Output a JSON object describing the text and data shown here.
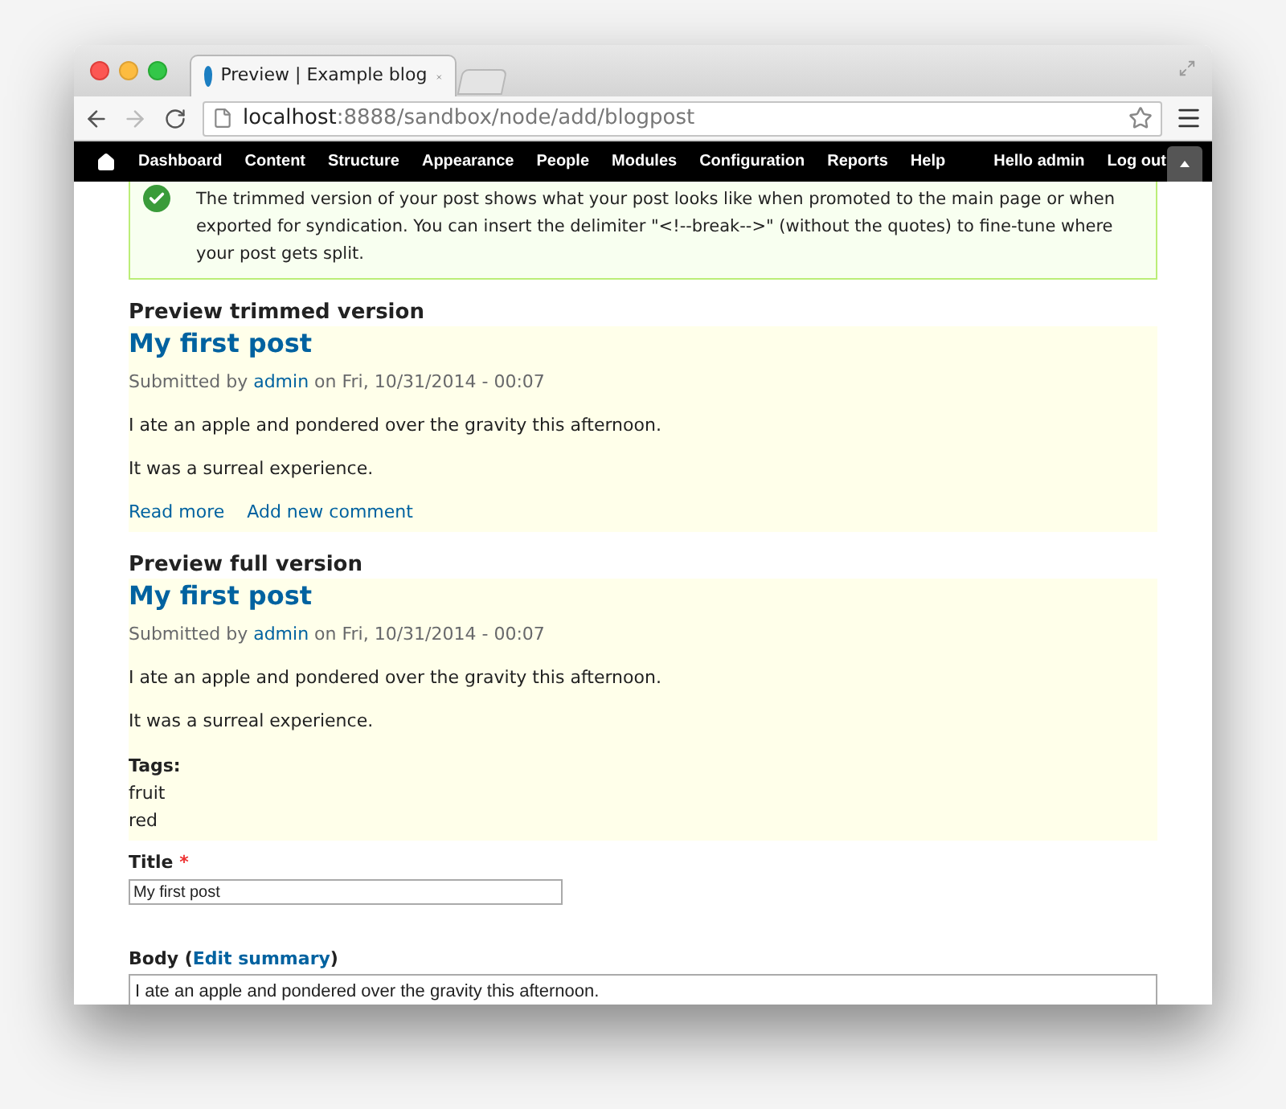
{
  "browser": {
    "tab_title": "Preview | Example blog",
    "url_host": "localhost",
    "url_path": ":8888/sandbox/node/add/blogpost"
  },
  "toolbar": {
    "items": [
      {
        "label": "Dashboard"
      },
      {
        "label": "Content"
      },
      {
        "label": "Structure"
      },
      {
        "label": "Appearance"
      },
      {
        "label": "People"
      },
      {
        "label": "Modules"
      },
      {
        "label": "Configuration"
      },
      {
        "label": "Reports"
      },
      {
        "label": "Help"
      }
    ],
    "user_items": [
      {
        "label": "Hello admin"
      },
      {
        "label": "Log out"
      }
    ]
  },
  "message": "The trimmed version of your post shows what your post looks like when promoted to the main page or when exported for syndication. You can insert the delimiter \"<!--break-->\" (without the quotes) to fine-tune where your post gets split.",
  "previews": [
    {
      "heading": "Preview trimmed version",
      "title": "My first post",
      "submitted": {
        "prefix": "Submitted by",
        "author": "admin",
        "suffix": "on Fri, 10/31/2014 - 00:07"
      },
      "paragraphs": [
        "I ate an apple and pondered over the gravity this afternoon.",
        "It was a surreal experience."
      ],
      "links": [
        "Read more",
        "Add new comment"
      ]
    },
    {
      "heading": "Preview full version",
      "title": "My first post",
      "submitted": {
        "prefix": "Submitted by",
        "author": "admin",
        "suffix": "on Fri, 10/31/2014 - 00:07"
      },
      "paragraphs": [
        "I ate an apple and pondered over the gravity this afternoon.",
        "It was a surreal experience."
      ],
      "tags": {
        "label": "Tags:",
        "items": [
          "fruit",
          "red"
        ]
      }
    }
  ],
  "form": {
    "title": {
      "label": "Title",
      "required_mark": "*",
      "value": "My first post"
    },
    "body": {
      "label_prefix": "Body (",
      "link": "Edit summary",
      "label_suffix": ")",
      "value": "I ate an apple and pondered over the gravity this afternoon."
    }
  }
}
